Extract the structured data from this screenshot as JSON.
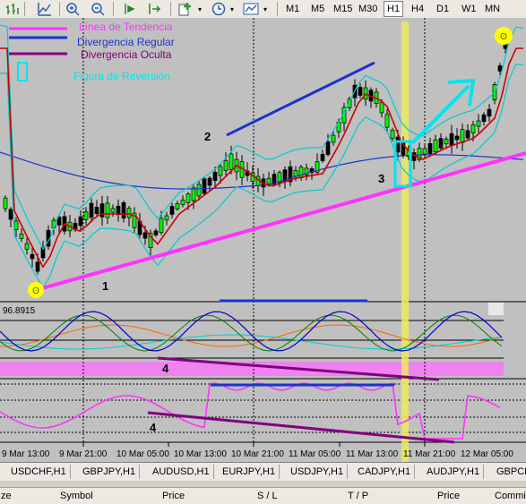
{
  "toolbar": {
    "icons": [
      {
        "name": "chart-bar-icon",
        "color": "#2f7d2f"
      },
      {
        "name": "chart-line-icon",
        "color": "#2f5faa"
      },
      {
        "name": "zoom-in-icon",
        "color": "#2f5faa"
      },
      {
        "name": "zoom-out-icon",
        "color": "#2f5faa"
      },
      {
        "name": "chart-shift-icon",
        "color": "#2f7d2f"
      },
      {
        "name": "autoscroll-icon",
        "color": "#2f7d2f"
      },
      {
        "name": "add-indicator-icon",
        "color": "#2f7d2f"
      },
      {
        "name": "periods-clock-icon",
        "color": "#2f5faa"
      },
      {
        "name": "templates-icon",
        "color": "#2f5faa"
      }
    ],
    "timeframes": [
      "M1",
      "M5",
      "M15",
      "M30",
      "H1",
      "H4",
      "D1",
      "W1",
      "MN"
    ]
  },
  "legend": {
    "trend_line": "Línea de Tendencia",
    "regular_divergence": "Divergencia Regular",
    "hidden_divergence": "Divergencia Oculta",
    "reversal_figure": "Figura de Reversión",
    "colors": {
      "trend": "#ff33ff",
      "regular": "#1a33cc",
      "hidden": "#800080",
      "reversal": "#00e5ee"
    }
  },
  "annotations": {
    "n1": "1",
    "n2": "2",
    "n3": "3",
    "n4a": "4",
    "n4b": "4"
  },
  "indicator": {
    "value_label": "96.8915"
  },
  "time_axis": [
    "9 Mar 13:00",
    "9 Mar 21:00",
    "10 Mar 05:00",
    "10 Mar 13:00",
    "10 Mar 21:00",
    "11 Mar 05:00",
    "11 Mar 13:00",
    "11 Mar 21:00",
    "12 Mar 05:00"
  ],
  "symbol_tabs": [
    "USDCHF,H1",
    "GBPJPY,H1",
    "AUDUSD,H1",
    "EURJPY,H1",
    "USDJPY,H1",
    "CADJPY,H1",
    "AUDJPY,H1",
    "GBPCH"
  ],
  "terminal_columns": [
    "ze",
    "Symbol",
    "Price",
    "S / L",
    "T / P",
    "Price",
    "Commi"
  ]
}
